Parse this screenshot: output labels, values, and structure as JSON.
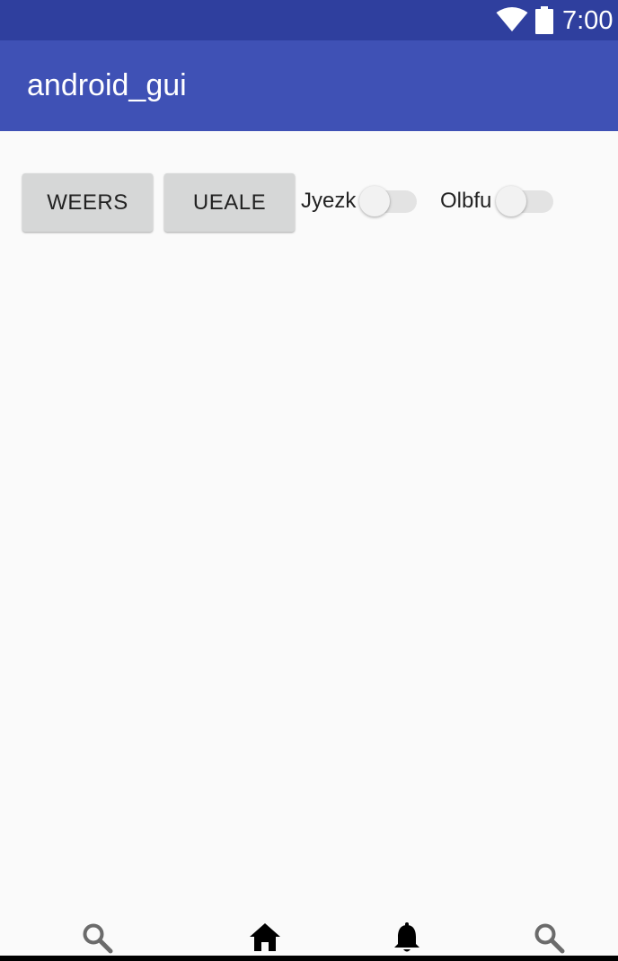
{
  "status_bar": {
    "time": "7:00",
    "wifi_icon": "wifi-icon",
    "battery_icon": "battery-icon",
    "background": "#2f3f9e"
  },
  "app_bar": {
    "title": "android_gui",
    "background": "#3f51b5"
  },
  "buttons": [
    {
      "label": "WEERS"
    },
    {
      "label": "UEALE"
    }
  ],
  "switches": [
    {
      "label": "Jyezk",
      "checked": false
    },
    {
      "label": "Olbfu",
      "checked": false
    }
  ],
  "bottom_nav": {
    "items": [
      {
        "icon": "search-icon",
        "color": "#6b6b6b"
      },
      {
        "icon": "home-icon",
        "color": "#000000"
      },
      {
        "icon": "bell-icon",
        "color": "#000000"
      },
      {
        "icon": "search-icon",
        "color": "#6b6b6b"
      }
    ]
  }
}
